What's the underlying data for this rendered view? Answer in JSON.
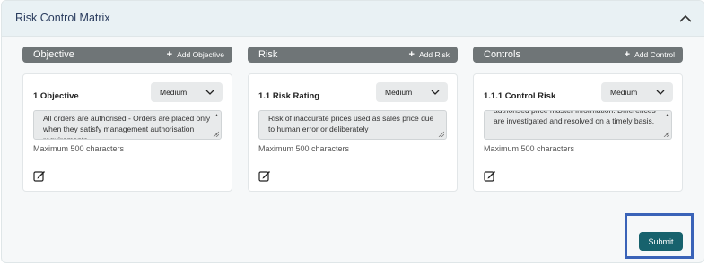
{
  "panel": {
    "title": "Risk Control Matrix"
  },
  "columns": [
    {
      "header": "Objective",
      "add_label": "Add Objective",
      "card": {
        "title": "1 Objective",
        "select_value": "Medium",
        "text": "All orders are authorised  -  Orders are placed only when they satisfy management authorisation requirements",
        "hint": "Maximum 500 characters"
      }
    },
    {
      "header": "Risk",
      "add_label": "Add Risk",
      "card": {
        "title": "1.1 Risk Rating",
        "select_value": "Medium",
        "text": "Risk of inaccurate prices used as sales price due to human error or deliberately",
        "hint": "Maximum 500 characters"
      }
    },
    {
      "header": "Controls",
      "add_label": "Add Control",
      "card": {
        "title": "1.1.1 Control Risk",
        "select_value": "Medium",
        "text": "authorised price master information. Differences are investigated and resolved on a timely basis.",
        "hint": "Maximum 500 characters"
      }
    }
  ],
  "submit": {
    "label": "Submit"
  },
  "colors": {
    "accent": "#17626d",
    "header_bar": "#6f7577",
    "highlight": "#3a63b8"
  }
}
